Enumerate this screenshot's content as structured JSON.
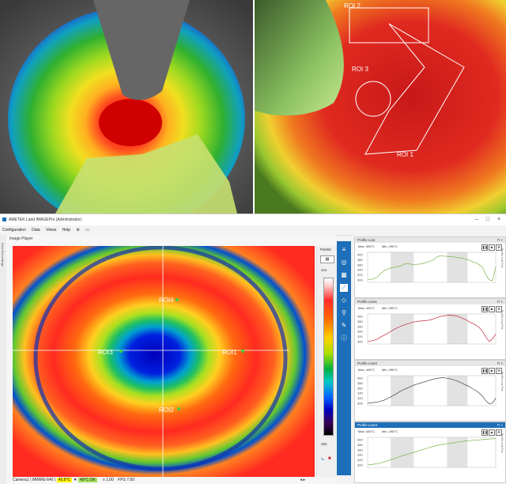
{
  "photos": {
    "right": {
      "roi_labels": [
        "ROI 2",
        "ROI 3",
        "ROI 1"
      ]
    }
  },
  "window": {
    "title": "AMETEK Land IMAGEPro (Administrator)"
  },
  "menu": [
    "Configuration",
    "Data",
    "Views",
    "Help"
  ],
  "player": {
    "title": "Image Player",
    "side_tab": "Area Recordings",
    "roi_labels": [
      "ROI4",
      "ROI3",
      "ROI1",
      "ROI2"
    ]
  },
  "palette": {
    "title": "Palette",
    "max_value": "421",
    "min_value": "250"
  },
  "status": {
    "camera": "Camera1 ( MWIRb 640 )",
    "temp_reading": "45.8°C",
    "ok_reading": "49°C OK",
    "zoom": "x 1.00",
    "fps": "FPS 7.00"
  },
  "profiles": [
    {
      "title": "Profile Line",
      "max": "Max: 405°C",
      "min": "Min: 295°C",
      "side": "Profile Line Pos",
      "active": false,
      "color": "#7ab24a",
      "y_ticks": [
        "400",
        "380",
        "360",
        "340",
        "320",
        "300"
      ],
      "values": [
        300,
        302,
        305,
        312,
        326,
        336,
        343,
        347,
        350,
        352,
        355,
        362,
        365,
        363,
        360,
        362,
        363,
        366,
        370,
        374,
        380,
        390,
        396,
        395,
        394,
        393,
        392,
        390,
        388,
        386,
        382,
        378,
        372,
        368,
        360,
        350,
        320,
        300,
        296,
        352
      ]
    },
    {
      "title": "Profile Line1",
      "max": "Max: 405°C",
      "min": "Min: 295°C",
      "side": "Profile Line Pos",
      "active": false,
      "color": "#c0283c",
      "y_ticks": [
        "400",
        "380",
        "360",
        "340",
        "320",
        "300"
      ],
      "values": [
        300,
        302,
        305,
        310,
        318,
        325,
        332,
        340,
        348,
        355,
        360,
        366,
        370,
        374,
        378,
        380,
        382,
        383,
        384,
        386,
        390,
        395,
        400,
        402,
        404,
        405,
        404,
        402,
        398,
        392,
        386,
        378,
        372,
        365,
        356,
        340,
        318,
        300,
        310,
        330
      ]
    },
    {
      "title": "Profile Line2",
      "max": "Max: 405°C",
      "min": "Min: 295°C",
      "side": "Profile Line Pos",
      "active": false,
      "color": "#444444",
      "y_ticks": [
        "400",
        "380",
        "360",
        "340",
        "320",
        "300"
      ],
      "values": [
        300,
        301,
        303,
        305,
        308,
        312,
        318,
        325,
        332,
        340,
        348,
        354,
        360,
        366,
        372,
        376,
        380,
        384,
        388,
        392,
        396,
        399,
        401,
        402,
        400,
        398,
        394,
        390,
        384,
        378,
        372,
        366,
        358,
        350,
        340,
        328,
        310,
        298,
        300,
        320
      ]
    },
    {
      "title": "Profile Line3",
      "max": "Max: 405°C",
      "min": "Min: 295°C",
      "side": "Profile Line Pos",
      "active": true,
      "color": "#7ab24a",
      "y_ticks": [
        "400",
        "380",
        "360",
        "340",
        "320",
        "300"
      ],
      "values": [
        300,
        301,
        303,
        305,
        308,
        312,
        316,
        320,
        325,
        330,
        334,
        338,
        342,
        346,
        350,
        354,
        358,
        362,
        366,
        370,
        374,
        377,
        380,
        382,
        384,
        386,
        388,
        390,
        392,
        394,
        396,
        397,
        398,
        399,
        400,
        401,
        402,
        403,
        404,
        405
      ]
    }
  ]
}
